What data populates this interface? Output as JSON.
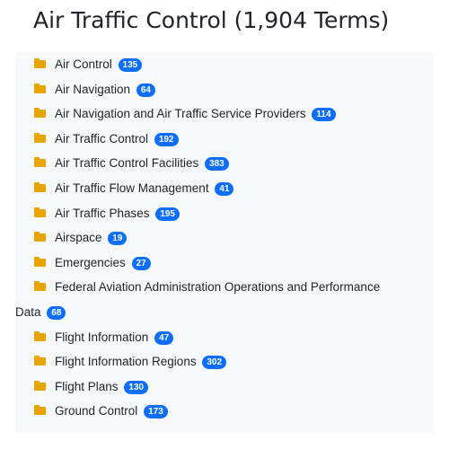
{
  "header": {
    "title": "Air Traffic Control (1,904 Terms)"
  },
  "theme": {
    "badge_color": "#0d6efd",
    "folder_color": "#e9a400",
    "panel_bg": "#f8f9fa"
  },
  "categories": [
    {
      "label": "Air Control",
      "count": "135",
      "icon": "folder-icon"
    },
    {
      "label": "Air Navigation",
      "count": "64",
      "icon": "folder-icon"
    },
    {
      "label": "Air Navigation and Air Traffic Service Providers",
      "count": "114",
      "icon": "folder-icon"
    },
    {
      "label": "Air Traffic Control",
      "count": "192",
      "icon": "folder-icon"
    },
    {
      "label": "Air Traffic Control Facilities",
      "count": "383",
      "icon": "folder-icon"
    },
    {
      "label": "Air Traffic Flow Management",
      "count": "41",
      "icon": "folder-icon"
    },
    {
      "label": "Air Traffic Phases",
      "count": "195",
      "icon": "folder-icon"
    },
    {
      "label": "Airspace",
      "count": "19",
      "icon": "folder-icon"
    },
    {
      "label": "Emergencies",
      "count": "27",
      "icon": "folder-icon"
    },
    {
      "label": "Federal Aviation Administration Operations and Performance",
      "label_cont": "Data",
      "count": "68",
      "icon": "folder-icon"
    },
    {
      "label": "Flight Information",
      "count": "47",
      "icon": "folder-icon"
    },
    {
      "label": "Flight Information Regions",
      "count": "302",
      "icon": "folder-icon"
    },
    {
      "label": "Flight Plans",
      "count": "130",
      "icon": "folder-icon"
    },
    {
      "label": "Ground Control",
      "count": "173",
      "icon": "folder-icon"
    }
  ]
}
